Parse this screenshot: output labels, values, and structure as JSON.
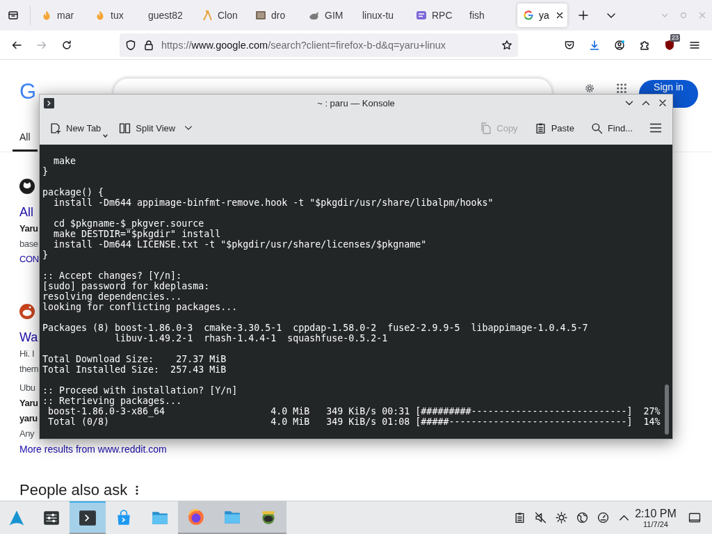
{
  "browser": {
    "tabs": [
      {
        "label": "mar",
        "selected": false
      },
      {
        "label": "tux",
        "selected": false
      },
      {
        "label": "guest82",
        "selected": false
      },
      {
        "label": "Clon",
        "selected": false
      },
      {
        "label": "dro",
        "selected": false
      },
      {
        "label": "GIM",
        "selected": false
      },
      {
        "label": "linux-tu",
        "selected": false
      },
      {
        "label": "RPC",
        "selected": false
      },
      {
        "label": "fish",
        "selected": false
      },
      {
        "label": "ya",
        "selected": true
      }
    ],
    "url": {
      "scheme": "https://",
      "host": "www.google.com",
      "path": "/search?client=firefox-b-d&q=yaru+linux"
    },
    "extension_badge": "23"
  },
  "google": {
    "logo": "G",
    "tab": "All",
    "sign_in": "Sign in",
    "results": [
      {
        "lines": [
          {
            "kind": "heading",
            "text": "All"
          },
          {
            "kind": "bold",
            "text": "Yaru"
          },
          {
            "kind": "snippet",
            "text": "base"
          },
          {
            "kind": "link",
            "text": "CON"
          }
        ]
      },
      {
        "lines": [
          {
            "kind": "heading",
            "text": "Wa"
          },
          {
            "kind": "snippet",
            "text": "Hi. I"
          },
          {
            "kind": "snippet",
            "text": "them"
          },
          {
            "kind": "meta",
            "text": "Ubu"
          },
          {
            "kind": "bold",
            "text": "Yaru"
          },
          {
            "kind": "bold",
            "text": "yaru"
          },
          {
            "kind": "snippet",
            "text": "Any"
          }
        ]
      }
    ],
    "more_results": "More results from www.reddit.com",
    "people_also_ask": "People also ask"
  },
  "konsole": {
    "title": "~ : paru — Konsole",
    "toolbar": [
      {
        "label": "New Tab",
        "disabled": false
      },
      {
        "label": "Split View",
        "disabled": false
      },
      {
        "label": "Copy",
        "disabled": true
      },
      {
        "label": "Paste",
        "disabled": false
      },
      {
        "label": "Find...",
        "disabled": false
      }
    ],
    "blocks": [
      [
        "  make",
        "}"
      ],
      [
        "package() {",
        "  install -Dm644 appimage-binfmt-remove.hook -t \"$pkgdir/usr/share/libalpm/hooks\""
      ],
      [
        "  cd $pkgname-$_pkgver.source",
        "  make DESTDIR=\"$pkgdir\" install",
        "  install -Dm644 LICENSE.txt -t \"$pkgdir/usr/share/licenses/$pkgname\"",
        "}"
      ],
      [
        ":: Accept changes? [Y/n]:",
        "[sudo] password for kdeplasma:",
        "resolving dependencies...",
        "looking for conflicting packages..."
      ],
      [
        "Packages (8) boost-1.86.0-3  cmake-3.30.5-1  cppdap-1.58.0-2  fuse2-2.9.9-5  libappimage-1.0.4.5-7",
        "             libuv-1.49.2-1  rhash-1.4.4-1  squashfuse-0.5.2-1"
      ],
      [
        "Total Download Size:    27.37 MiB",
        "Total Installed Size:  257.43 MiB"
      ],
      [
        ":: Proceed with installation? [Y/n]",
        ":: Retrieving packages...",
        " boost-1.86.0-3-x86_64                   4.0 MiB   349 KiB/s 00:31 [#########----------------------------]  27%",
        " Total (0/8)                             4.0 MiB   349 KiB/s 01:08 [#####--------------------------------]  14%"
      ]
    ]
  },
  "taskbar": {
    "apps": [
      {
        "running": false,
        "selected": false
      },
      {
        "running": true,
        "selected": true
      },
      {
        "running": false,
        "selected": false
      },
      {
        "running": false,
        "selected": false
      },
      {
        "running": true,
        "selected": false
      },
      {
        "running": true,
        "selected": false
      },
      {
        "running": true,
        "selected": false
      }
    ],
    "clock": {
      "time": "2:10 PM",
      "date": "11/7/24"
    }
  }
}
